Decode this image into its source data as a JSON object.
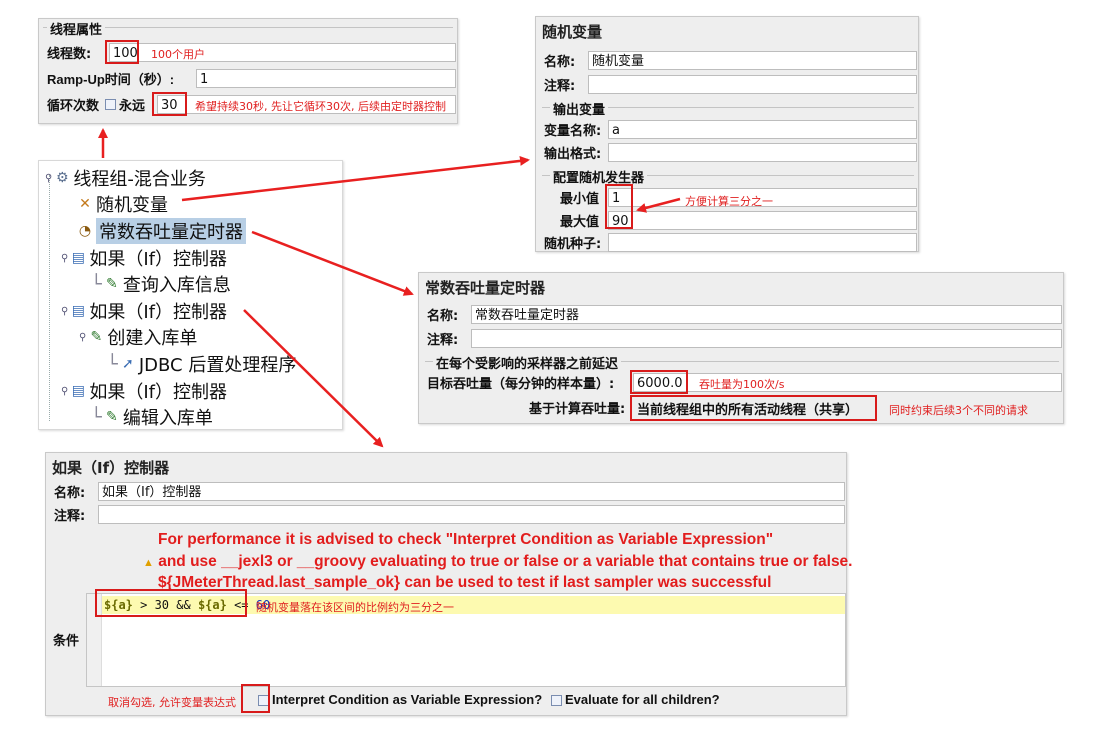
{
  "thread_props": {
    "title": "线程属性",
    "threads_label": "线程数:",
    "threads_value": "100",
    "threads_note": "100个用户",
    "rampup_label": "Ramp-Up时间（秒）:",
    "rampup_value": "1",
    "loop_label": "循环次数",
    "forever_label": "永远",
    "loop_value": "30",
    "loop_note": "希望持续30秒, 先让它循环30次, 后续由定时器控制"
  },
  "tree": {
    "items": [
      {
        "label": "线程组-混合业务",
        "icon": "gear-icon"
      },
      {
        "label": "随机变量",
        "icon": "wrench-icon"
      },
      {
        "label": "常数吞吐量定时器",
        "icon": "timer-icon"
      },
      {
        "label": "如果（If）控制器",
        "icon": "controller-icon"
      },
      {
        "label": "查询入库信息",
        "icon": "pencil-icon"
      },
      {
        "label": "如果（If）控制器",
        "icon": "controller-icon"
      },
      {
        "label": "创建入库单",
        "icon": "pencil-icon"
      },
      {
        "label": "JDBC 后置处理程序",
        "icon": "postprocessor-icon"
      },
      {
        "label": "如果（If）控制器",
        "icon": "controller-icon"
      },
      {
        "label": "编辑入库单",
        "icon": "pencil-icon"
      }
    ]
  },
  "random_var": {
    "title": "随机变量",
    "name_label": "名称:",
    "name_value": "随机变量",
    "comment_label": "注释:",
    "output_section": "输出变量",
    "varname_label": "变量名称:",
    "varname_value": "a",
    "format_label": "输出格式:",
    "gen_section": "配置随机发生器",
    "min_label": "最小值",
    "min_value": "1",
    "max_label": "最大值",
    "max_value": "90",
    "seed_label": "随机种子:",
    "min_note": "方便计算三分之一"
  },
  "timer": {
    "title": "常数吞吐量定时器",
    "name_label": "名称:",
    "name_value": "常数吞吐量定时器",
    "comment_label": "注释:",
    "section": "在每个受影响的采样器之前延迟",
    "target_label": "目标吞吐量（每分钟的样本量）:",
    "target_value": "6000.0",
    "target_note": "吞吐量为100次/s",
    "based_label": "基于计算吞吐量:",
    "based_value": "当前线程组中的所有活动线程（共享）",
    "based_note": "同时约束后续3个不同的请求"
  },
  "if_ctrl": {
    "title": "如果（If）控制器",
    "name_label": "名称:",
    "name_value": "如果（If）控制器",
    "comment_label": "注释:",
    "hint1": "For performance it is advised to check \"Interpret Condition as Variable Expression\"",
    "hint2": "and use __jexl3 or __groovy evaluating to true or false or a variable that contains true or false.",
    "hint3": "${JMeterThread.last_sample_ok} can be used to test if last sampler was successful",
    "cond_label": "条件",
    "cond_var1": "${a}",
    "cond_op1": " > 30 && ",
    "cond_var2": "${a}",
    "cond_op2": " <= ",
    "cond_num": "60",
    "cond_note": "随机变量落在该区间的比例约为三分之一",
    "interpret_label": "Interpret Condition as Variable Expression?",
    "evaluate_label": "Evaluate for all children?",
    "uncheck_note": "取消勾选, 允许变量表达式"
  }
}
